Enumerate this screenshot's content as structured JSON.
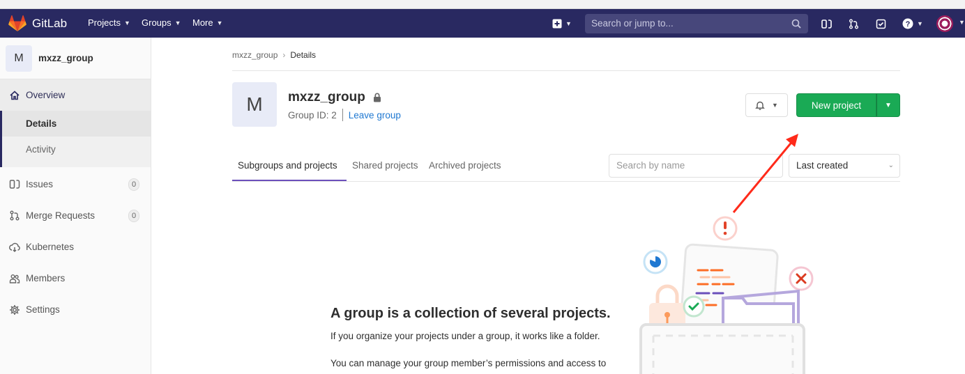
{
  "navbar": {
    "brand": "GitLab",
    "menus": [
      "Projects",
      "Groups",
      "More"
    ],
    "search_placeholder": "Search or jump to...",
    "brand_color": "#292961"
  },
  "sidebar": {
    "group_initial": "M",
    "group_name": "mxzz_group",
    "overview": "Overview",
    "details": "Details",
    "activity": "Activity",
    "items": [
      {
        "label": "Issues",
        "icon": "issues-icon",
        "count": "0"
      },
      {
        "label": "Merge Requests",
        "icon": "merge-request-icon",
        "count": "0"
      },
      {
        "label": "Kubernetes",
        "icon": "kubernetes-icon"
      },
      {
        "label": "Members",
        "icon": "members-icon"
      },
      {
        "label": "Settings",
        "icon": "gear-icon"
      }
    ]
  },
  "breadcrumb": {
    "group": "mxzz_group",
    "current": "Details"
  },
  "group": {
    "initial": "M",
    "name": "mxzz_group",
    "group_id": "Group ID: 2",
    "leave": "Leave group"
  },
  "actions": {
    "new_project": "New project",
    "accent": "#1aaa55"
  },
  "tabs": [
    "Subgroups and projects",
    "Shared projects",
    "Archived projects"
  ],
  "filter": {
    "placeholder": "Search by name",
    "sort": "Last created"
  },
  "empty_state": {
    "title": "A group is a collection of several projects.",
    "p1": "If you organize your projects under a group, it works like a folder.",
    "p2": "You can manage your group member’s permissions and access to"
  }
}
